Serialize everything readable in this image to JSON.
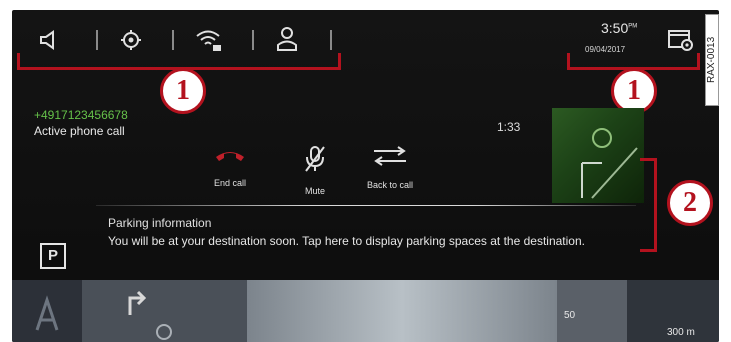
{
  "status_bar": {
    "time": "3:50",
    "time_suffix": "PM",
    "date": "09/04/2017",
    "icons": [
      "volume-icon",
      "settings-icon",
      "wifi-icon",
      "profile-icon",
      "calendar-settings-icon"
    ]
  },
  "callouts": {
    "callout_1": "1",
    "callout_2": "2",
    "image_code": "RAX-0013"
  },
  "phone_call": {
    "number": "+4917123456678",
    "status": "Active phone call",
    "duration": "1:33",
    "actions": {
      "end_call": "End call",
      "mute": "Mute",
      "back_to_call": "Back to call"
    },
    "colors": {
      "number": "#66c24a",
      "end_call": "#c0202a"
    }
  },
  "parking": {
    "icon": "P",
    "title": "Parking information",
    "message": "You will be at your destination soon. Tap here to display parking spaces at the destination."
  },
  "map_bar": {
    "speed": "50",
    "distance": "300 m"
  }
}
